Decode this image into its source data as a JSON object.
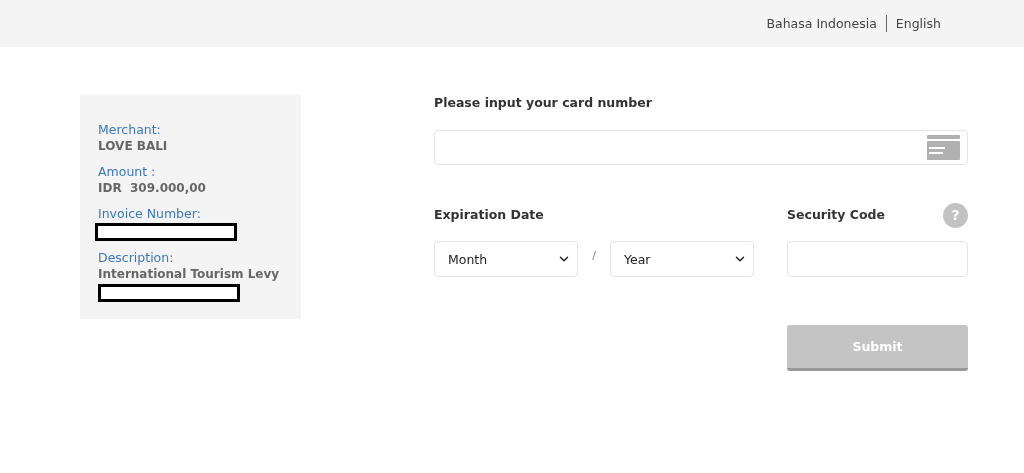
{
  "language_switcher": [
    "Bahasa Indonesia",
    "English"
  ],
  "invoice": [
    {
      "label": "Merchant:",
      "value": "LOVE BALI",
      "redacted": false
    },
    {
      "label": "Amount :",
      "value": "IDR  309.000,00",
      "redacted": false
    },
    {
      "label": "Invoice Number:",
      "redacted": true
    },
    {
      "label": "Description:",
      "value": "International Tourism Levy",
      "redacted": true
    }
  ],
  "card_number": {
    "label": "Please input your card number"
  },
  "expiration": {
    "label": "Expiration Date",
    "month": "Month",
    "separator": "/",
    "year": "Year"
  },
  "security_code": {
    "label": "Security Code",
    "help": "?"
  },
  "submit": {
    "label": "Submit",
    "disabled": true
  }
}
